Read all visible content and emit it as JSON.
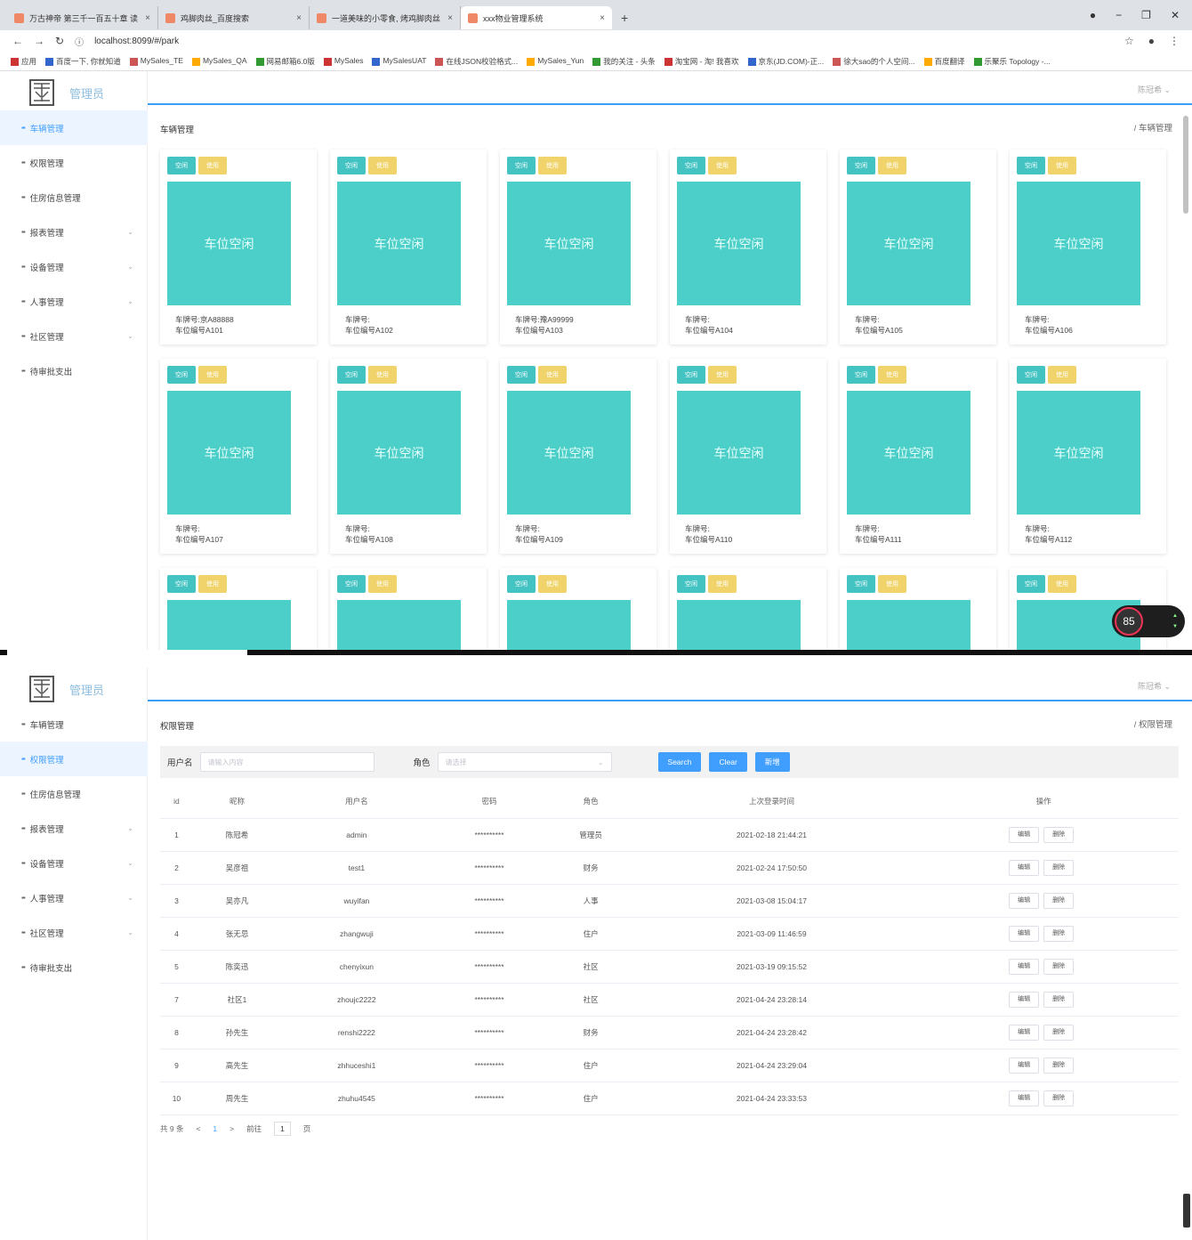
{
  "browser": {
    "tabs": [
      {
        "title": "万古神帝 第三千一百五十章 读",
        "active": false
      },
      {
        "title": "鸡脚肉丝_百度搜索",
        "active": false
      },
      {
        "title": "一道美味的小零食, 烤鸡脚肉丝",
        "active": false
      },
      {
        "title": "xxx物业管理系统",
        "active": true
      }
    ],
    "url": "localhost:8099/#/park",
    "bookmarks": [
      "应用",
      "百度一下, 你就知道",
      "MySales_TE",
      "MySales_QA",
      "网易邮箱6.0版",
      "MySales",
      "MySalesUAT",
      "在线JSON校验格式...",
      "MySales_Yun",
      "我的关注 - 头条",
      "淘宝网 - 淘! 我喜欢",
      "京东(JD.COM)-正...",
      "徐大sao的个人空间...",
      "百度翻译",
      "乐聚乐 Topology -..."
    ]
  },
  "app": {
    "brand": "管理员",
    "user": "陈冠希",
    "menu": [
      {
        "label": "车辆管理",
        "has_submenu": false
      },
      {
        "label": "权限管理",
        "has_submenu": false
      },
      {
        "label": "住房信息管理",
        "has_submenu": false
      },
      {
        "label": "报表管理",
        "has_submenu": true
      },
      {
        "label": "设备管理",
        "has_submenu": true
      },
      {
        "label": "人事管理",
        "has_submenu": true
      },
      {
        "label": "社区管理",
        "has_submenu": true
      },
      {
        "label": "待审批支出",
        "has_submenu": false
      }
    ]
  },
  "park": {
    "title": "车辆管理",
    "crumb": "/ 车辆管理",
    "tag_free": "空闲",
    "tag_used": "使用",
    "slot_text": "车位空闲",
    "plate_label": "车牌号:",
    "slot_label": "车位编号",
    "cards": [
      {
        "plate": "京A88888",
        "slot": "A101"
      },
      {
        "plate": "",
        "slot": "A102"
      },
      {
        "plate": "豫A99999",
        "slot": "A103"
      },
      {
        "plate": "",
        "slot": "A104"
      },
      {
        "plate": "",
        "slot": "A105"
      },
      {
        "plate": "",
        "slot": "A106"
      },
      {
        "plate": "",
        "slot": "A107"
      },
      {
        "plate": "",
        "slot": "A108"
      },
      {
        "plate": "",
        "slot": "A109"
      },
      {
        "plate": "",
        "slot": "A110"
      },
      {
        "plate": "",
        "slot": "A111"
      },
      {
        "plate": "",
        "slot": "A112"
      },
      {
        "plate": "",
        "slot": ""
      },
      {
        "plate": "",
        "slot": ""
      },
      {
        "plate": "",
        "slot": ""
      },
      {
        "plate": "",
        "slot": ""
      },
      {
        "plate": "",
        "slot": ""
      },
      {
        "plate": "",
        "slot": ""
      }
    ],
    "perf_badge": "85"
  },
  "perm": {
    "title": "权限管理",
    "crumb": "/ 权限管理",
    "username_label": "用户名",
    "username_placeholder": "请输入内容",
    "role_label": "角色",
    "role_placeholder": "请选择",
    "btn_search": "Search",
    "btn_clear": "Clear",
    "btn_add": "新增",
    "columns": [
      "id",
      "昵称",
      "用户名",
      "密码",
      "角色",
      "上次登录时间",
      "操作"
    ],
    "rows": [
      [
        "1",
        "陈冠希",
        "admin",
        "**********",
        "管理员",
        "2021-02-18 21:44:21"
      ],
      [
        "2",
        "吴彦祖",
        "test1",
        "**********",
        "财务",
        "2021-02-24 17:50:50"
      ],
      [
        "3",
        "吴亦凡",
        "wuyifan",
        "**********",
        "人事",
        "2021-03-08 15:04:17"
      ],
      [
        "4",
        "张无忌",
        "zhangwuji",
        "**********",
        "住户",
        "2021-03-09 11:46:59"
      ],
      [
        "5",
        "陈奕迅",
        "chenyixun",
        "**********",
        "社区",
        "2021-03-19 09:15:52"
      ],
      [
        "7",
        "社区1",
        "zhoujc2222",
        "**********",
        "社区",
        "2021-04-24 23:28:14"
      ],
      [
        "8",
        "孙先生",
        "renshi2222",
        "**********",
        "财务",
        "2021-04-24 23:28:42"
      ],
      [
        "9",
        "高先生",
        "zhhuceshi1",
        "**********",
        "住户",
        "2021-04-24 23:29:04"
      ],
      [
        "10",
        "周先生",
        "zhuhu4545",
        "**********",
        "住户",
        "2021-04-24 23:33:53"
      ]
    ],
    "edit_label": "编辑",
    "delete_label": "删除",
    "pager": {
      "total": "共 9 条",
      "prev": "<",
      "page": "1",
      "next": ">",
      "goto": "前往",
      "goto_value": "1",
      "unit": "页"
    }
  },
  "colors": {
    "accent": "#409eff",
    "slot": "#4ccfc8",
    "tag_free": "#43c3c2",
    "tag_used": "#f0d36a"
  }
}
